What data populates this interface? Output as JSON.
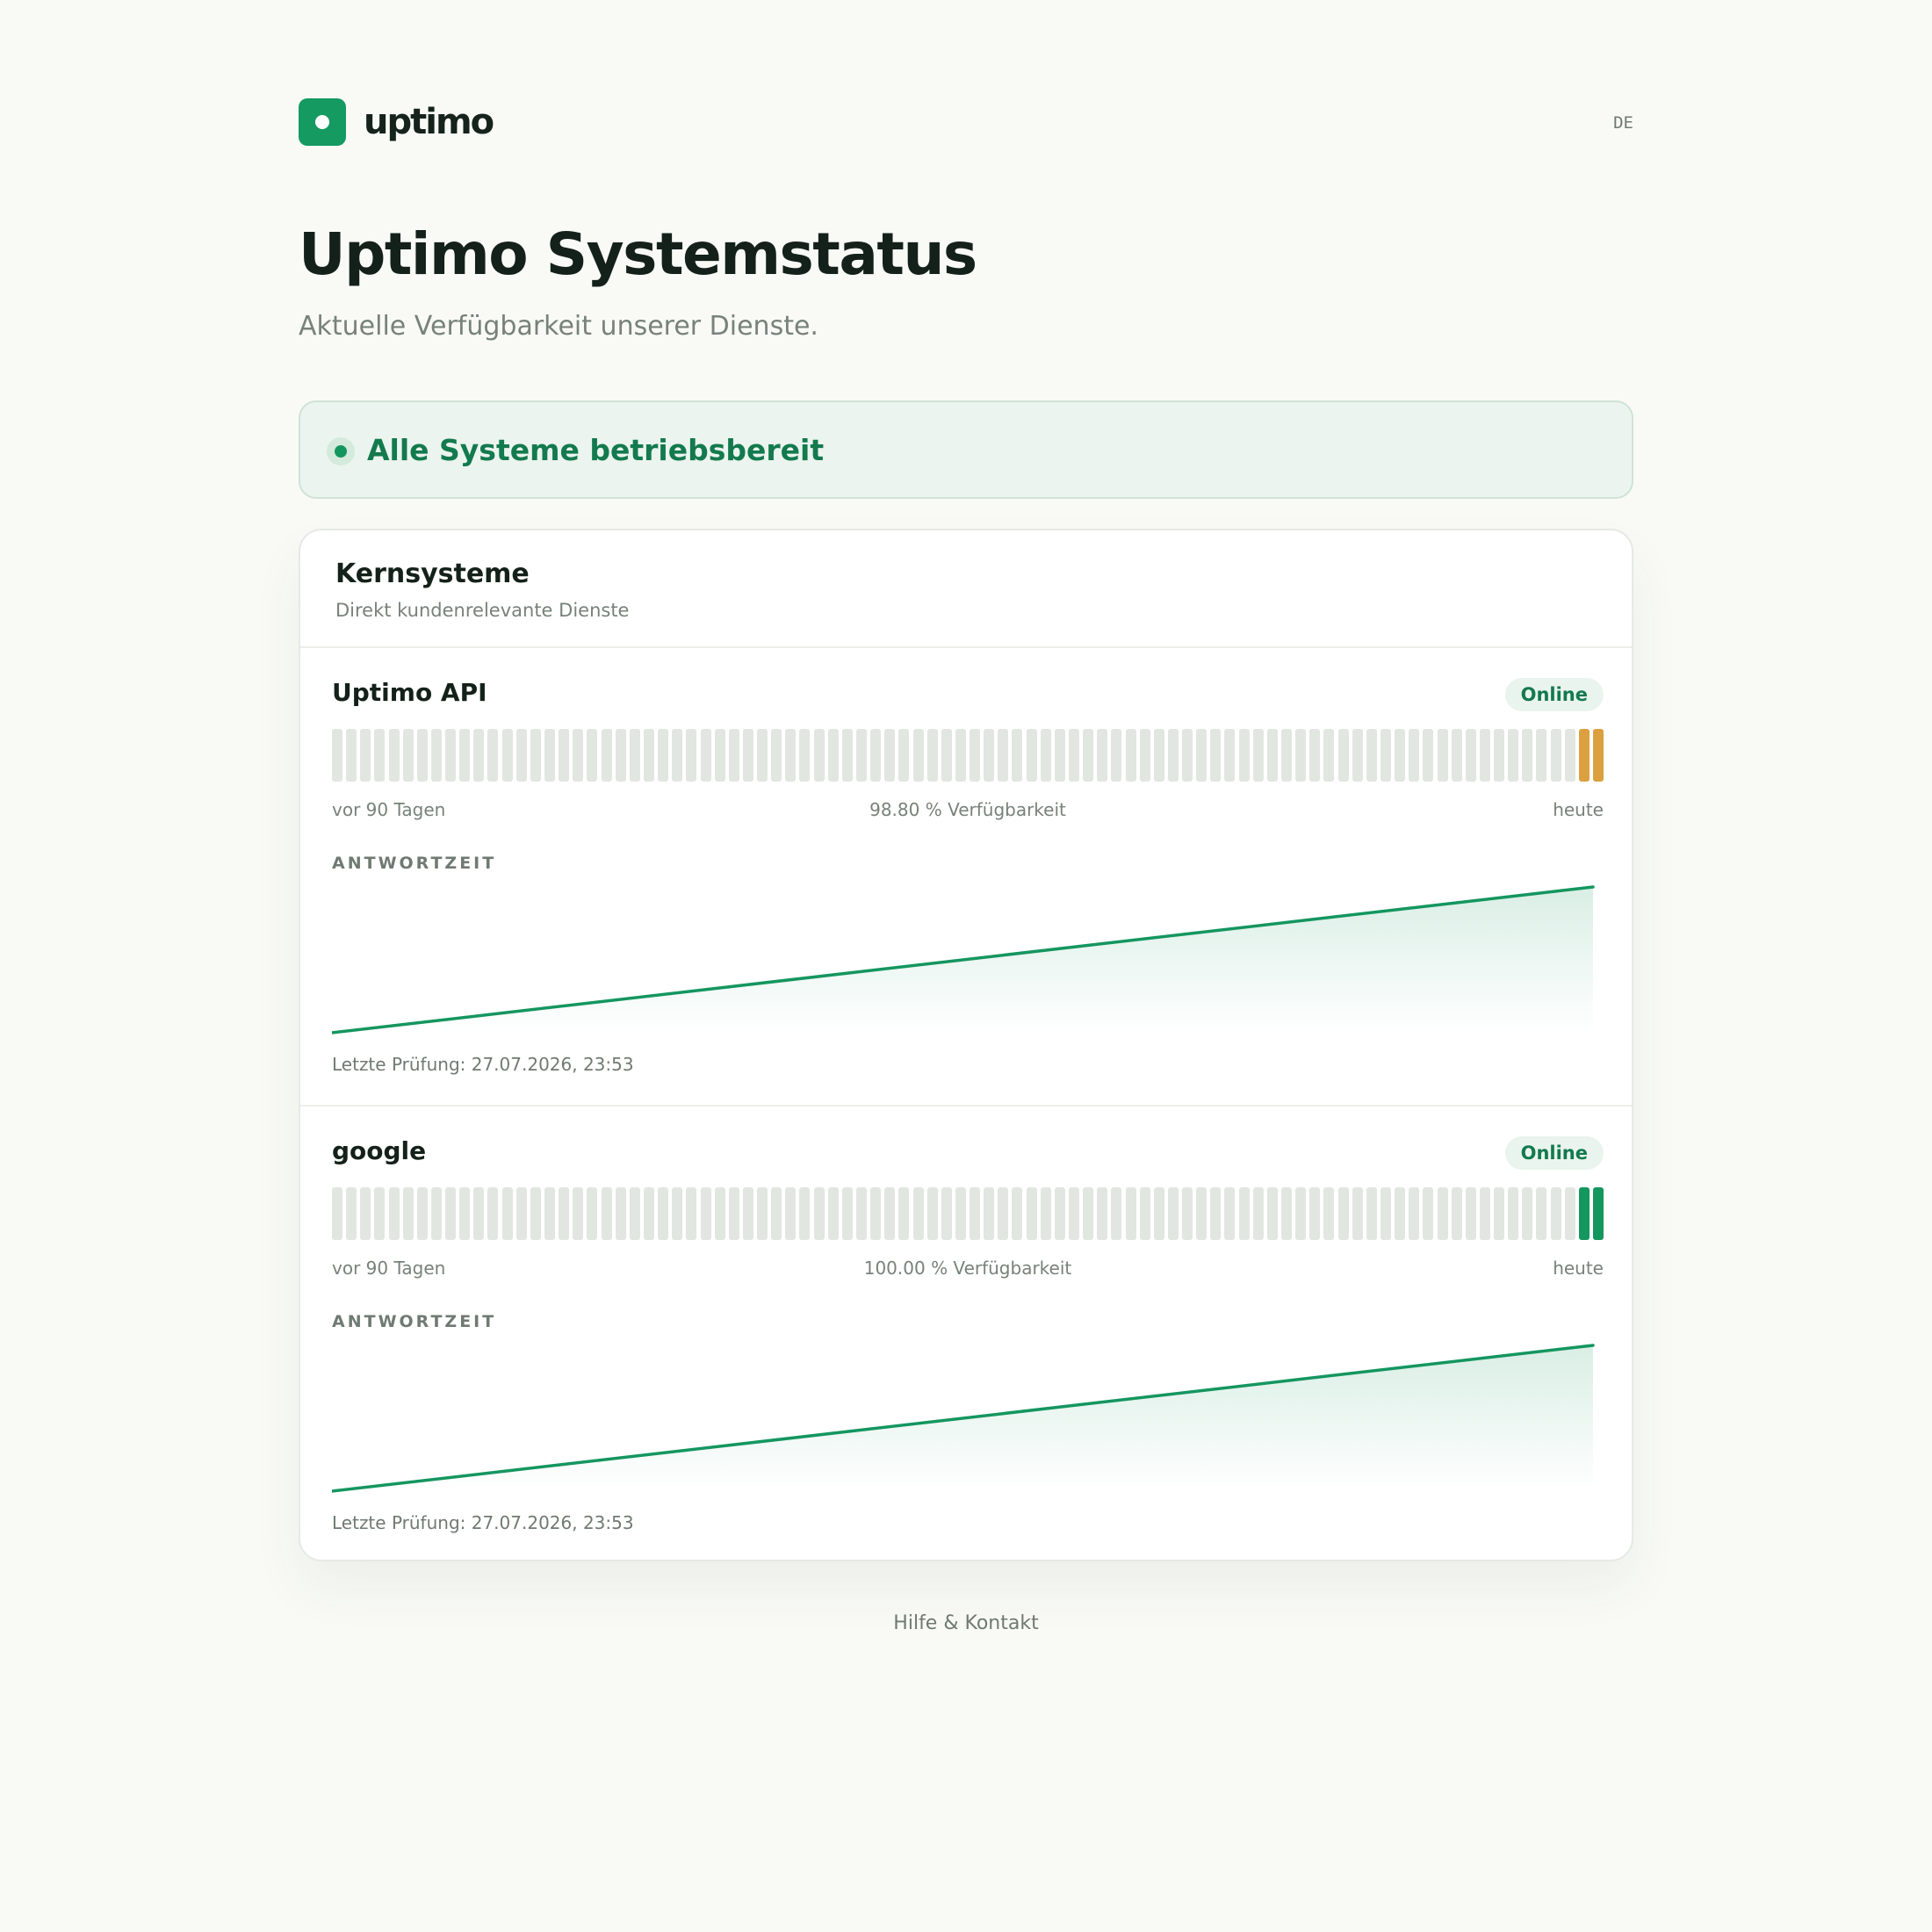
{
  "brand": {
    "name": "uptimo",
    "language": "DE"
  },
  "page": {
    "title": "Uptimo Systemstatus",
    "subtitle": "Aktuelle Verfügbarkeit unserer Dienste."
  },
  "overall_status": {
    "text": "Alle Systeme betriebsbereit"
  },
  "group": {
    "title": "Kernsysteme",
    "subtitle": "Direkt kundenrelevante Dienste",
    "services": [
      {
        "name": "Uptimo API",
        "status": "Online",
        "range_start_label": "vor 90 Tagen",
        "uptime_label": "98.80 % Verfügbarkeit",
        "range_end_label": "heute",
        "bar_count": 90,
        "bars_with_data": [
          {
            "day_from_end": 2,
            "state": "degraded"
          },
          {
            "day_from_end": 1,
            "state": "degraded"
          }
        ],
        "response_time_label": "ANTWORTZEIT",
        "last_check": "Letzte Prüfung: 27.07.2026, 23:53"
      },
      {
        "name": "google",
        "status": "Online",
        "range_start_label": "vor 90 Tagen",
        "uptime_label": "100.00 % Verfügbarkeit",
        "range_end_label": "heute",
        "bar_count": 90,
        "bars_with_data": [
          {
            "day_from_end": 2,
            "state": "operational"
          },
          {
            "day_from_end": 1,
            "state": "operational"
          }
        ],
        "response_time_label": "ANTWORTZEIT",
        "last_check": "Letzte Prüfung: 27.07.2026, 23:53"
      }
    ]
  },
  "footer": {
    "link": "Hilfe & Kontakt"
  },
  "colors": {
    "accent": "#159a62",
    "operational": "#14965f",
    "degraded": "#dca040",
    "no_data": "#e2e6e1",
    "background": "#f9faf6"
  }
}
